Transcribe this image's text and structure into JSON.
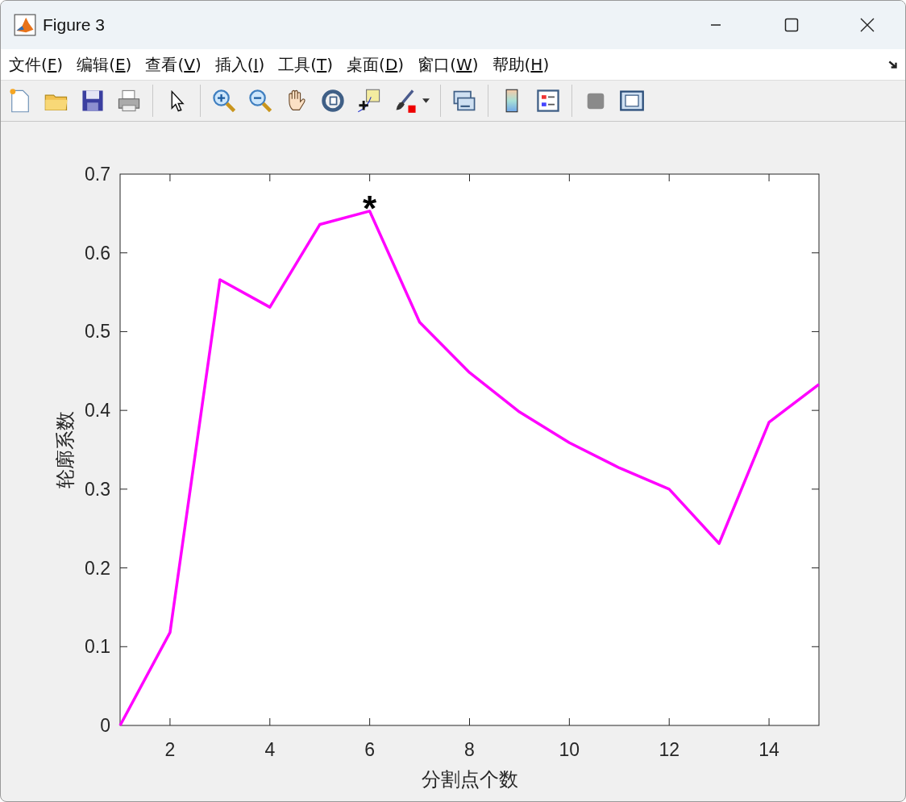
{
  "window": {
    "title": "Figure 3"
  },
  "menu": [
    {
      "label": "文件(F)"
    },
    {
      "label": "编辑(E)"
    },
    {
      "label": "查看(V)"
    },
    {
      "label": "插入(I)"
    },
    {
      "label": "工具(T)"
    },
    {
      "label": "桌面(D)"
    },
    {
      "label": "窗口(W)"
    },
    {
      "label": "帮助(H)"
    }
  ],
  "figure": {
    "chart_data": {
      "type": "line",
      "xlabel": "分割点个数",
      "ylabel": "轮廓系数",
      "x": [
        1,
        2,
        3,
        4,
        5,
        6,
        7,
        8,
        9,
        10,
        11,
        12,
        13,
        14,
        15
      ],
      "series": [
        {
          "color": "#ff00ff",
          "values": [
            0,
            0.118,
            0.566,
            0.531,
            0.636,
            0.653,
            0.512,
            0.448,
            0.398,
            0.359,
            0.327,
            0.3,
            0.231,
            0.385,
            0.433
          ]
        }
      ],
      "xlim": [
        1,
        15
      ],
      "ylim": [
        0,
        0.7
      ],
      "xticks": [
        2,
        4,
        6,
        8,
        10,
        12,
        14
      ],
      "yticks": [
        {
          "value": 0,
          "label": "0"
        },
        {
          "value": 0.1,
          "label": "0.1"
        },
        {
          "value": 0.2,
          "label": "0.2"
        },
        {
          "value": 0.3,
          "label": "0.3"
        },
        {
          "value": 0.4,
          "label": "0.4"
        },
        {
          "value": 0.5,
          "label": "0.5"
        },
        {
          "value": 0.6,
          "label": "0.6"
        },
        {
          "value": 0.7,
          "label": "0.7"
        }
      ],
      "annotations": [
        {
          "text": "*",
          "x": 6,
          "y": 0.653
        }
      ]
    }
  }
}
